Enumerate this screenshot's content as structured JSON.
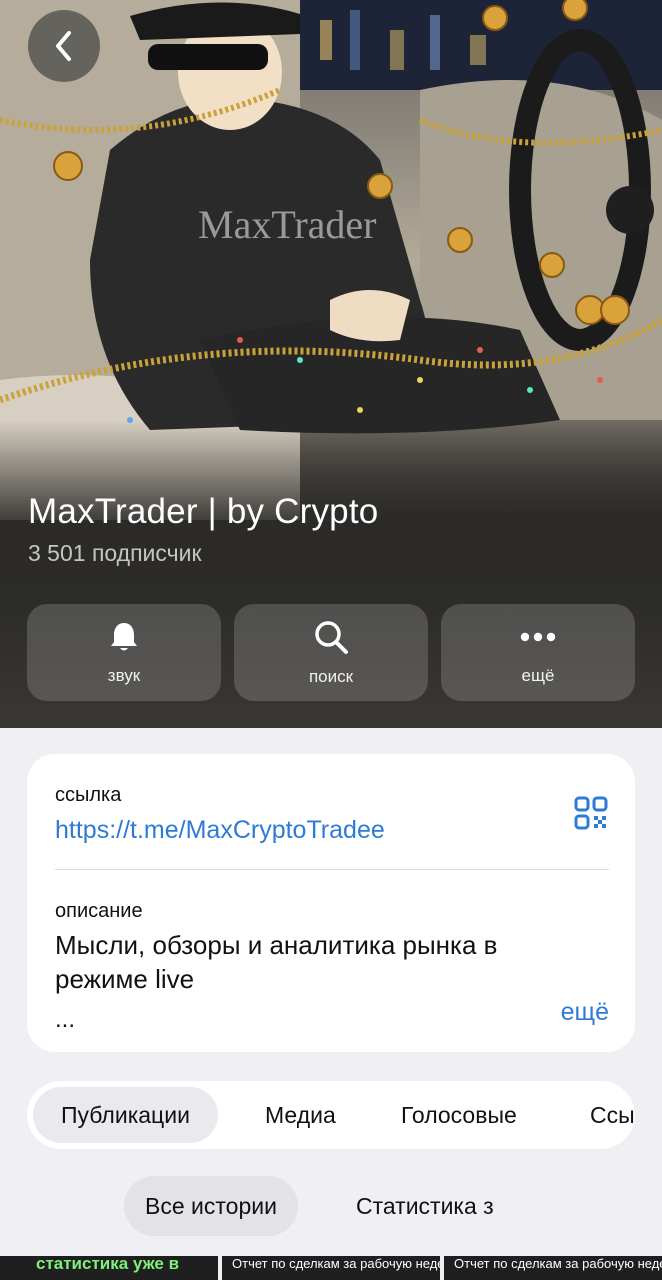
{
  "header": {
    "channel_title": "MaxTrader | by Crypto",
    "subscribers": "3 501 подписчик",
    "hoodie_text": "MaxTrader"
  },
  "actions": [
    {
      "label": "звук",
      "icon": "bell-icon"
    },
    {
      "label": "поиск",
      "icon": "search-icon"
    },
    {
      "label": "ещё",
      "icon": "more-dots-icon"
    }
  ],
  "info": {
    "link_label": "ссылка",
    "link_url": "https://t.me/MaxCryptoTradee",
    "description_label": "описание",
    "description": "Мысли, обзоры и аналитика рынка в режиме live",
    "ellipsis": "...",
    "more": "ещё"
  },
  "tabs": [
    "Публикации",
    "Медиа",
    "Голосовые",
    "Ссылки"
  ],
  "story_chips": [
    "Все истории",
    "Статистика з"
  ],
  "posts": [
    "статистика уже в",
    "Отчет по сделкам за рабочую неделю:",
    "Отчет по сделкам за рабочую неделю:"
  ],
  "colors": {
    "accent": "#2e7bd6",
    "card_bg": "#ffffff",
    "page_bg": "#efeff4"
  }
}
